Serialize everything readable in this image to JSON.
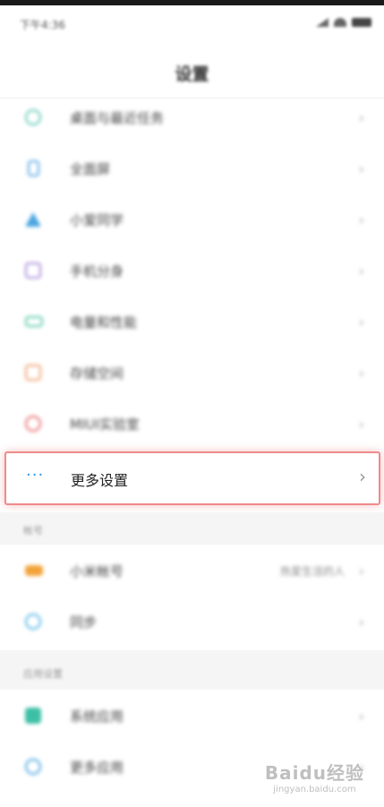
{
  "status_bar": {
    "time": "下午4:36"
  },
  "header": {
    "title": "设置"
  },
  "section_main": {
    "items": [
      {
        "label": "桌面与最近任务",
        "icon": "home-icon",
        "color": "#5fc8b4"
      },
      {
        "label": "全面屏",
        "icon": "fullscreen-icon",
        "color": "#5aa6e6"
      },
      {
        "label": "小爱同学",
        "icon": "assistant-icon",
        "color": "#4aa6e0"
      },
      {
        "label": "手机分身",
        "icon": "dual-apps-icon",
        "color": "#a78ad8"
      },
      {
        "label": "电量和性能",
        "icon": "battery-icon",
        "color": "#58c8a8"
      },
      {
        "label": "存储空间",
        "icon": "storage-icon",
        "color": "#f0a070"
      },
      {
        "label": "MIUI实验室",
        "icon": "lab-icon",
        "color": "#e86a6a"
      }
    ],
    "more_settings": {
      "label": "更多设置",
      "icon": "more-dots-icon"
    }
  },
  "section_account": {
    "title": "帐号",
    "items": [
      {
        "label": "小米帐号",
        "value": "热爱生活的人",
        "icon": "mi-account-icon",
        "color": "#f2a43a"
      },
      {
        "label": "同步",
        "icon": "sync-icon",
        "color": "#52b6e8"
      }
    ]
  },
  "section_apps": {
    "title": "应用设置",
    "items": [
      {
        "label": "系统应用",
        "icon": "system-apps-icon",
        "color": "#3dbfa6"
      },
      {
        "label": "更多应用",
        "icon": "more-apps-icon",
        "color": "#4aa6e0"
      }
    ]
  },
  "watermark": {
    "logo": "Baidu经验",
    "url": "jingyan.baidu.com"
  },
  "colors": {
    "highlight_border": "#ef8b8b",
    "accent_blue": "#2a9be8"
  }
}
